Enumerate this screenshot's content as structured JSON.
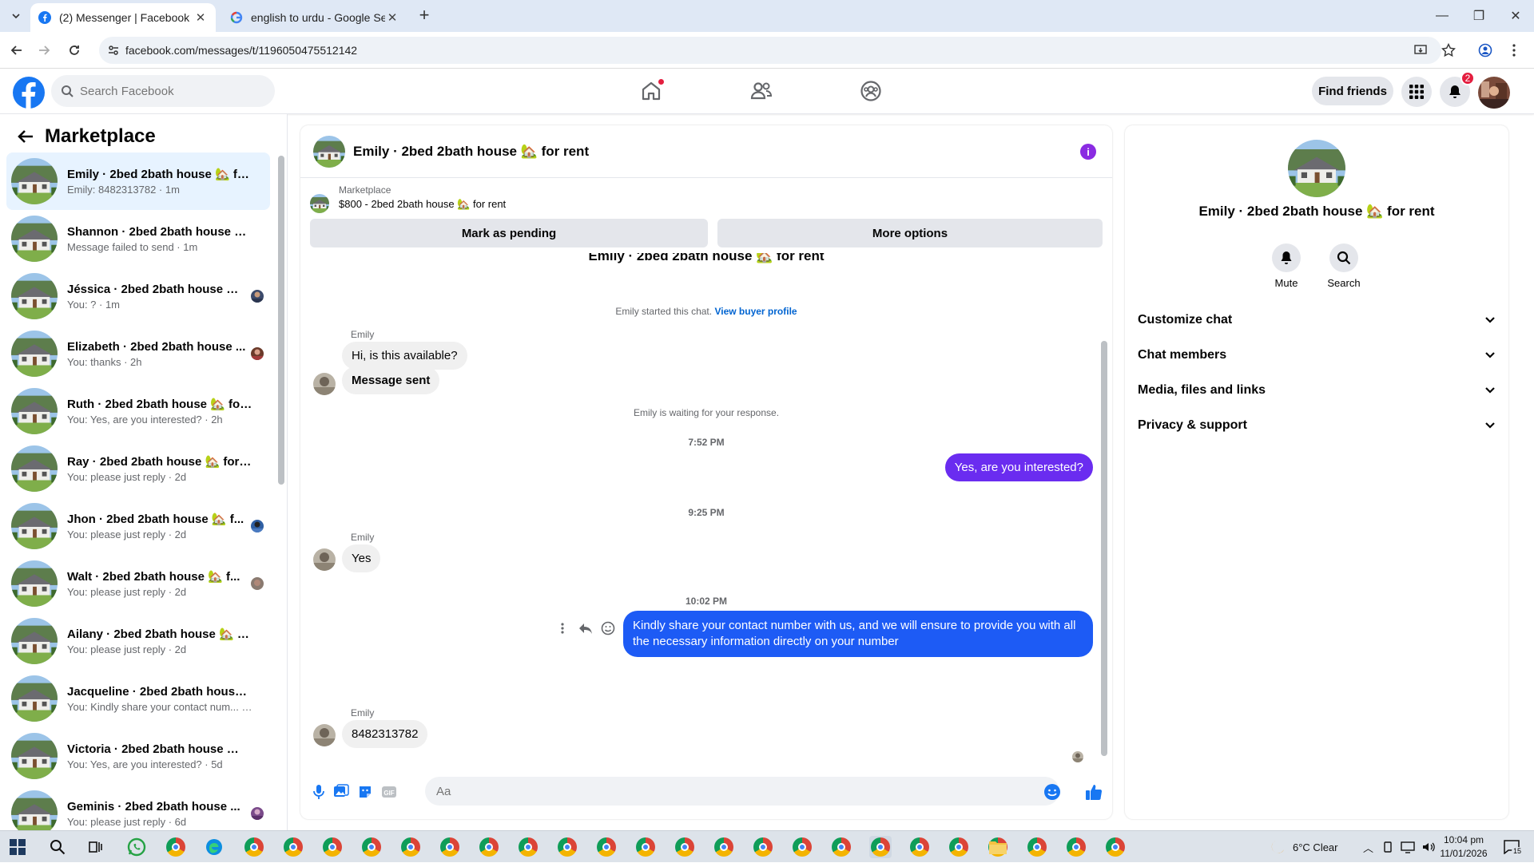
{
  "browser": {
    "tabs": [
      {
        "title": "(2) Messenger | Facebook",
        "active": true
      },
      {
        "title": "english to urdu - Google Search",
        "active": false
      }
    ],
    "url": "facebook.com/messages/t/1196050475512142"
  },
  "fb_header": {
    "search_placeholder": "Search Facebook",
    "find_friends_label": "Find friends",
    "notification_count": "2",
    "brand_color": "#1877f2"
  },
  "sidebar": {
    "title": "Marketplace",
    "conversations": [
      {
        "name": "Emily · 2bed 2bath house 🏡 for...",
        "snippet": "Emily: 8482313782 · 1m",
        "selected": true
      },
      {
        "name": "Shannon · 2bed 2bath house 🏡 ...",
        "snippet": "Message failed to send · 1m"
      },
      {
        "name": "Jéssica · 2bed 2bath house 🏡 ...",
        "snippet": "You: ? · 1m"
      },
      {
        "name": "Elizabeth · 2bed 2bath house ...",
        "snippet": "You: thanks · 2h"
      },
      {
        "name": "Ruth · 2bed 2bath house 🏡 for ...",
        "snippet": "You: Yes, are you interested? · 2h"
      },
      {
        "name": "Ray · 2bed 2bath house 🏡 for r...",
        "snippet": "You: please just reply · 2d"
      },
      {
        "name": "Jhon · 2bed 2bath house 🏡 f...",
        "snippet": "You: please just reply · 2d"
      },
      {
        "name": "Walt · 2bed 2bath house 🏡 f...",
        "snippet": "You: please just reply · 2d"
      },
      {
        "name": "Ailany · 2bed 2bath house 🏡 fo...",
        "snippet": "You: please just reply · 2d"
      },
      {
        "name": "Jacqueline · 2bed 2bath house ...",
        "snippet": "You: Kindly share your contact num... · 5d"
      },
      {
        "name": "Victoria · 2bed 2bath house 🏡 f...",
        "snippet": "You: Yes, are you interested? · 5d"
      },
      {
        "name": "Geminis · 2bed 2bath house ...",
        "snippet": "You: please just reply · 6d"
      }
    ]
  },
  "chat": {
    "title": "Emily · 2bed 2bath house 🏡 for rent",
    "marketplace_label": "Marketplace",
    "listing": "$800 - 2bed 2bath house 🏡 for rent",
    "mark_pending_label": "Mark as pending",
    "more_options_label": "More options",
    "top_title": "Emily · 2bed 2bath house 🏡 for rent",
    "started_note": "Emily started this chat.",
    "buyer_profile_link": "View buyer profile",
    "sender_name": "Emily",
    "msg1": "Hi, is this available?",
    "msg2": "Message sent",
    "waiting_note": "Emily is waiting for your response.",
    "time1": "7:52 PM",
    "out1": "Yes, are you interested?",
    "time2": "9:25 PM",
    "msg3": "Yes",
    "time3": "10:02 PM",
    "out2": "Kindly share your contact number with us, and we will ensure to provide you with all the necessary information directly on your number",
    "msg4": "8482313782",
    "composer_placeholder": "Aa",
    "out_color_1": "#6a2cf0",
    "out_color_2": "#1d5bf5"
  },
  "details": {
    "name": "Emily · 2bed 2bath house 🏡 for rent",
    "mute_label": "Mute",
    "search_label": "Search",
    "sections": [
      "Customize chat",
      "Chat members",
      "Media, files and links",
      "Privacy & support"
    ]
  },
  "taskbar": {
    "weather": "6°C  Clear",
    "time": "10:04 pm",
    "date": "11/01/2026",
    "notif_count": "15"
  }
}
